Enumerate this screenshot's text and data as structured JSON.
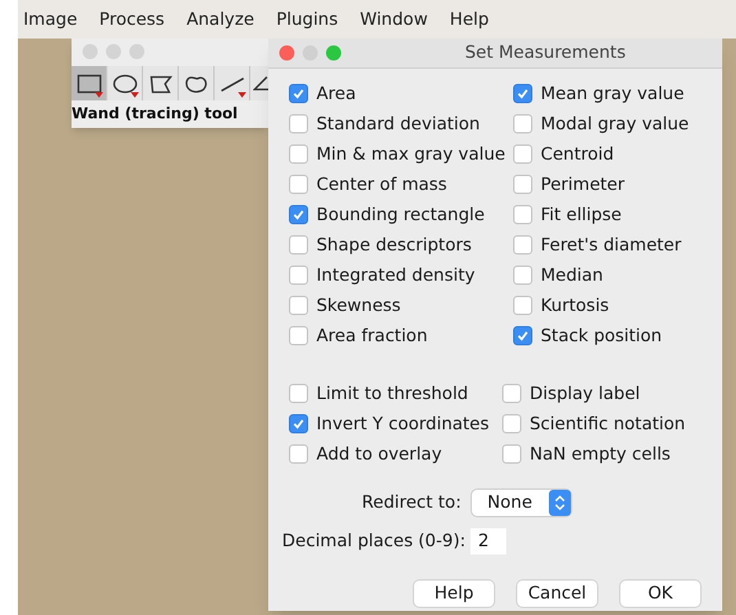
{
  "menu_bar": [
    "Image",
    "Process",
    "Analyze",
    "Plugins",
    "Window",
    "Help"
  ],
  "toolbar_window": {
    "tools": [
      {
        "kind": "rectangle",
        "selected": true,
        "has_menu": true
      },
      {
        "kind": "oval",
        "selected": false,
        "has_menu": true
      },
      {
        "kind": "polygon",
        "selected": false,
        "has_menu": false
      },
      {
        "kind": "freehand",
        "selected": false,
        "has_menu": false
      },
      {
        "kind": "line",
        "selected": false,
        "has_menu": true
      },
      {
        "kind": "angle",
        "selected": false,
        "has_menu": false
      }
    ],
    "status": "Wand (tracing) tool"
  },
  "dialog": {
    "title": "Set Measurements",
    "measurements": [
      {
        "label": "Area",
        "checked": true
      },
      {
        "label": "Mean gray value",
        "checked": true
      },
      {
        "label": "Standard deviation",
        "checked": false
      },
      {
        "label": "Modal gray value",
        "checked": false
      },
      {
        "label": "Min & max gray value",
        "checked": false
      },
      {
        "label": "Centroid",
        "checked": false
      },
      {
        "label": "Center of mass",
        "checked": false
      },
      {
        "label": "Perimeter",
        "checked": false
      },
      {
        "label": "Bounding rectangle",
        "checked": true
      },
      {
        "label": "Fit ellipse",
        "checked": false
      },
      {
        "label": "Shape descriptors",
        "checked": false
      },
      {
        "label": "Feret's diameter",
        "checked": false
      },
      {
        "label": "Integrated density",
        "checked": false
      },
      {
        "label": "Median",
        "checked": false
      },
      {
        "label": "Skewness",
        "checked": false
      },
      {
        "label": "Kurtosis",
        "checked": false
      },
      {
        "label": "Area fraction",
        "checked": false
      },
      {
        "label": "Stack position",
        "checked": true
      }
    ],
    "options": [
      {
        "label": "Limit to threshold",
        "checked": false
      },
      {
        "label": "Display label",
        "checked": false
      },
      {
        "label": "Invert Y coordinates",
        "checked": true
      },
      {
        "label": "Scientific notation",
        "checked": false
      },
      {
        "label": "Add to overlay",
        "checked": false
      },
      {
        "label": "NaN empty cells",
        "checked": false
      }
    ],
    "redirect": {
      "label": "Redirect to:",
      "value": "None"
    },
    "decimal_places": {
      "label": "Decimal places (0-9):",
      "value": "2"
    },
    "buttons": [
      "Help",
      "Cancel",
      "OK"
    ]
  }
}
